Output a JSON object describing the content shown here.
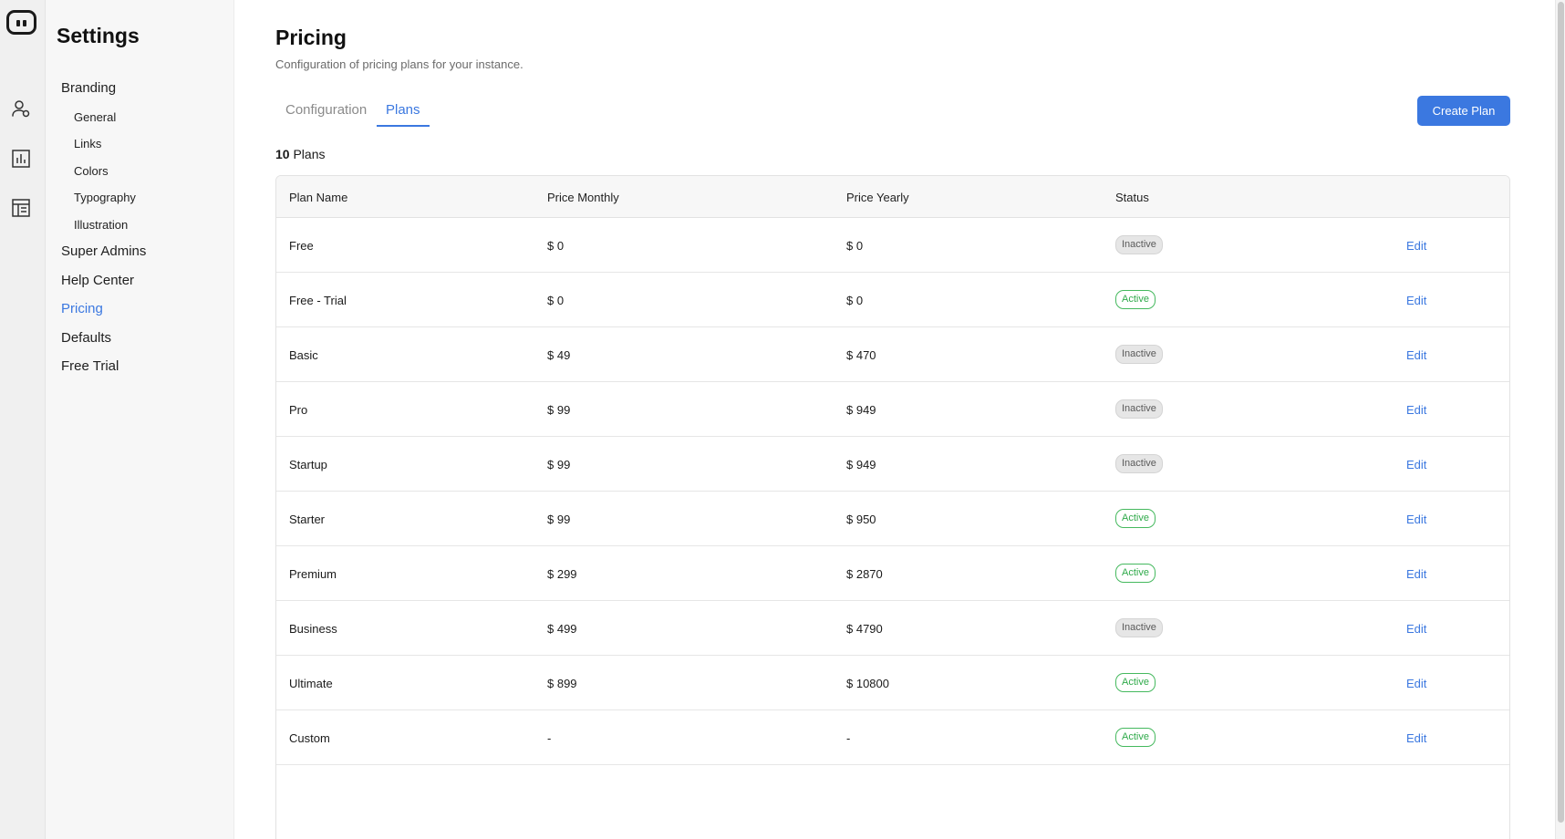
{
  "sidebar": {
    "title": "Settings",
    "items": [
      {
        "label": "Branding"
      },
      {
        "label": "Super Admins"
      },
      {
        "label": "Help Center"
      },
      {
        "label": "Pricing"
      },
      {
        "label": "Defaults"
      },
      {
        "label": "Free Trial"
      }
    ],
    "branding_sub": [
      "General",
      "Links",
      "Colors",
      "Typography",
      "Illustration"
    ]
  },
  "rail": {
    "icons": [
      "logo-icon",
      "users-icon",
      "bar-chart-icon",
      "layout-icon"
    ]
  },
  "page": {
    "title": "Pricing",
    "subtitle": "Configuration of pricing plans for your instance."
  },
  "tabs": [
    {
      "label": "Configuration",
      "active": false
    },
    {
      "label": "Plans",
      "active": true
    }
  ],
  "create_button": "Create Plan",
  "plan_count": {
    "number": "10",
    "label": "Plans"
  },
  "table": {
    "columns": [
      "Plan Name",
      "Price Monthly",
      "Price Yearly",
      "Status"
    ],
    "rows": [
      {
        "name": "Free",
        "monthly": "$ 0",
        "yearly": "$ 0",
        "status": "Inactive",
        "action": "Edit"
      },
      {
        "name": "Free - Trial",
        "monthly": "$ 0",
        "yearly": "$ 0",
        "status": "Active",
        "action": "Edit"
      },
      {
        "name": "Basic",
        "monthly": "$ 49",
        "yearly": "$ 470",
        "status": "Inactive",
        "action": "Edit"
      },
      {
        "name": "Pro",
        "monthly": "$ 99",
        "yearly": "$ 949",
        "status": "Inactive",
        "action": "Edit"
      },
      {
        "name": "Startup",
        "monthly": "$ 99",
        "yearly": "$ 949",
        "status": "Inactive",
        "action": "Edit"
      },
      {
        "name": "Starter",
        "monthly": "$ 99",
        "yearly": "$ 950",
        "status": "Active",
        "action": "Edit"
      },
      {
        "name": "Premium",
        "monthly": "$ 299",
        "yearly": "$ 2870",
        "status": "Active",
        "action": "Edit"
      },
      {
        "name": "Business",
        "monthly": "$ 499",
        "yearly": "$ 4790",
        "status": "Inactive",
        "action": "Edit"
      },
      {
        "name": "Ultimate",
        "monthly": "$ 899",
        "yearly": "$ 10800",
        "status": "Active",
        "action": "Edit"
      },
      {
        "name": "Custom",
        "monthly": "-",
        "yearly": "-",
        "status": "Active",
        "action": "Edit"
      }
    ]
  },
  "colors": {
    "accent": "#3b78e0",
    "active_green": "#2faa4a",
    "inactive_gray": "#5a5a5a"
  }
}
